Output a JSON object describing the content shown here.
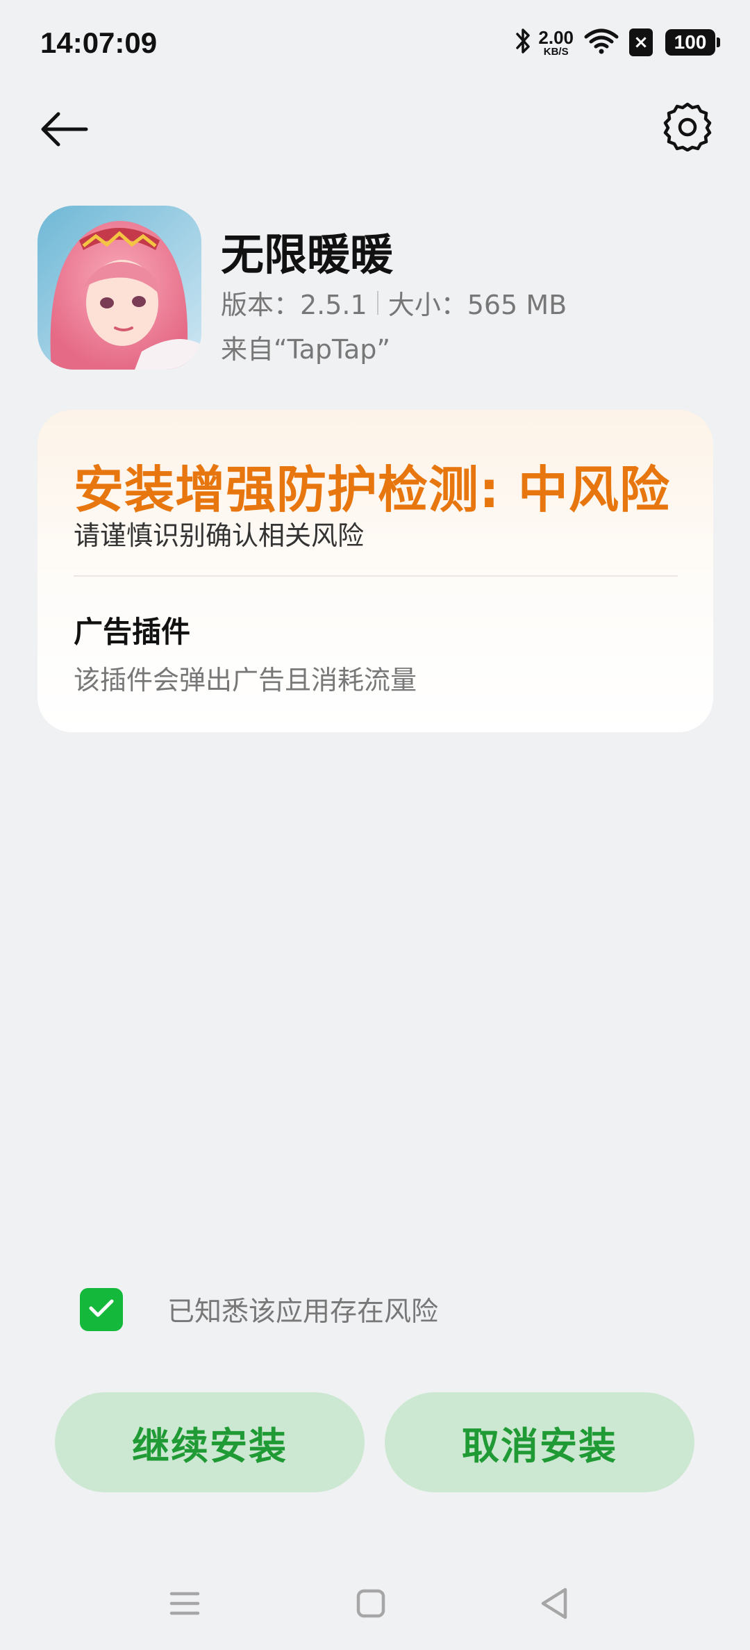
{
  "status_bar": {
    "time": "14:07:09",
    "net_speed_value": "2.00",
    "net_speed_unit": "KB/S",
    "sim_label": "×",
    "battery": "100"
  },
  "top_bar": {
    "back_icon": "arrow-left-icon",
    "settings_icon": "gear-icon"
  },
  "app": {
    "name": "无限暖暖",
    "version": "版本：2.5.1",
    "size": "大小：565 MB",
    "source": "来自“TapTap”"
  },
  "risk_card": {
    "title": "安装增强防护检测: 中风险",
    "subtitle": "请谨慎识别确认相关风险",
    "item_title": "广告插件",
    "item_desc": "该插件会弹出广告且消耗流量",
    "accent_color": "#e8760f"
  },
  "acknowledge": {
    "checked": true,
    "label": "已知悉该应用存在风险"
  },
  "buttons": {
    "continue": "继续安装",
    "cancel": "取消安装"
  },
  "nav_bar": {
    "menu_icon": "menu-icon",
    "home_icon": "home-square-icon",
    "back_icon": "back-triangle-icon"
  }
}
